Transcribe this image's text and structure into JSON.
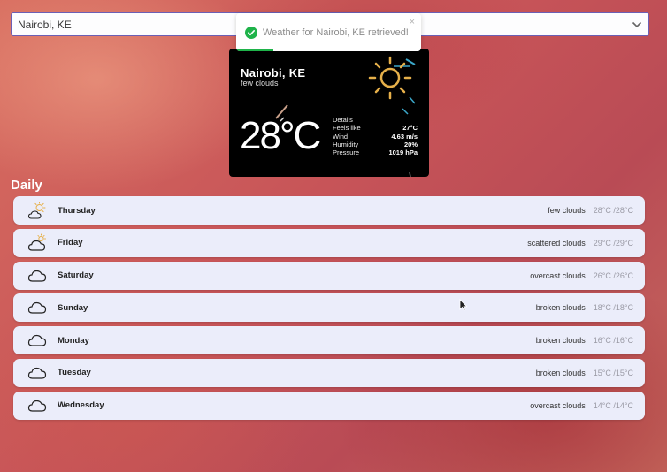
{
  "location_select": {
    "value": "Nairobi, KE"
  },
  "toast": {
    "message": "Weather for Nairobi, KE retrieved!",
    "close": "×",
    "progress": 0.2
  },
  "current": {
    "city": "Nairobi, KE",
    "description": "few clouds",
    "temperature": "28°C",
    "icon": "sun-icon",
    "details_label": "Details",
    "details": [
      {
        "label": "Feels like",
        "value": "27°C"
      },
      {
        "label": "Wind",
        "value": "4.63 m/s"
      },
      {
        "label": "Humidity",
        "value": "20%"
      },
      {
        "label": "Pressure",
        "value": "1019 hPa"
      }
    ]
  },
  "daily": {
    "title": "Daily",
    "days": [
      {
        "day": "Thursday",
        "condition": "few clouds",
        "range": "28°C /28°C",
        "icon": "sun-cloud-icon"
      },
      {
        "day": "Friday",
        "condition": "scattered clouds",
        "range": "29°C /29°C",
        "icon": "cloud-sun-icon"
      },
      {
        "day": "Saturday",
        "condition": "overcast clouds",
        "range": "26°C /26°C",
        "icon": "cloud-icon"
      },
      {
        "day": "Sunday",
        "condition": "broken clouds",
        "range": "18°C /18°C",
        "icon": "cloud-icon"
      },
      {
        "day": "Monday",
        "condition": "broken clouds",
        "range": "16°C /16°C",
        "icon": "cloud-icon"
      },
      {
        "day": "Tuesday",
        "condition": "broken clouds",
        "range": "15°C /15°C",
        "icon": "cloud-icon"
      },
      {
        "day": "Wednesday",
        "condition": "overcast clouds",
        "range": "14°C /14°C",
        "icon": "cloud-icon"
      }
    ]
  },
  "colors": {
    "accent": "#1fb34a",
    "card_bg": "#000000",
    "row_bg": "#ebedfa",
    "sun": "#e6b04a"
  }
}
